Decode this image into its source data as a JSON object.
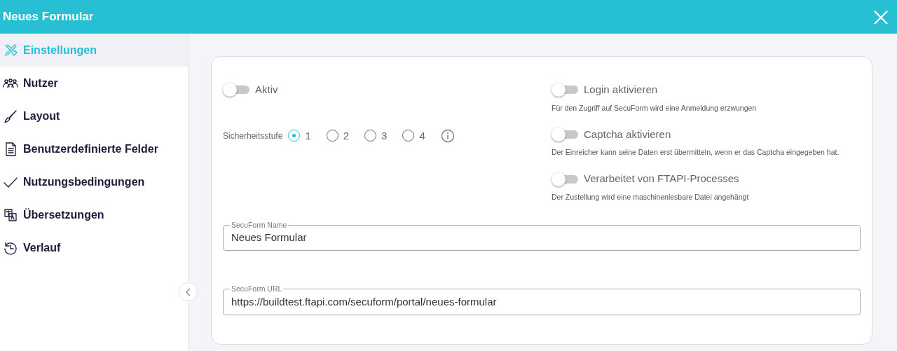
{
  "window": {
    "title": "Neues Formular"
  },
  "sidebar": {
    "items": [
      {
        "label": "Einstellungen",
        "selected": true
      },
      {
        "label": "Nutzer",
        "selected": false
      },
      {
        "label": "Layout",
        "selected": false
      },
      {
        "label": "Benutzerdefinierte Felder",
        "selected": false
      },
      {
        "label": "Nutzungsbedingungen",
        "selected": false
      },
      {
        "label": "Übersetzungen",
        "selected": false
      },
      {
        "label": "Verlauf",
        "selected": false
      }
    ]
  },
  "settings": {
    "active": {
      "label": "Aktiv",
      "on": false
    },
    "security_level": {
      "label": "Sicherheitsstufe",
      "options": [
        {
          "label": "1",
          "selected": true
        },
        {
          "label": "2",
          "selected": false
        },
        {
          "label": "3",
          "selected": false
        },
        {
          "label": "4",
          "selected": false
        }
      ]
    },
    "options": [
      {
        "label": "Login aktivieren",
        "hint": "Für den Zugriff auf SecuForm wird eine Anmeldung erzwungen",
        "on": false
      },
      {
        "label": "Captcha aktivieren",
        "hint": "Der Einreicher kann seine Daten erst übermitteln, wenn er das Captcha eingegeben hat.",
        "on": false
      },
      {
        "label": "Verarbeitet von FTAPI-Processes",
        "hint": "Der Zustellung wird eine maschinenlesbare Datei angehängt",
        "on": false
      }
    ]
  },
  "fields": [
    {
      "label": "SecuForm Name",
      "value": "Neues Formular"
    },
    {
      "label": "SecuForm URL",
      "value": "https://buildtest.ftapi.com/secuform/portal/neues-formular"
    }
  ]
}
